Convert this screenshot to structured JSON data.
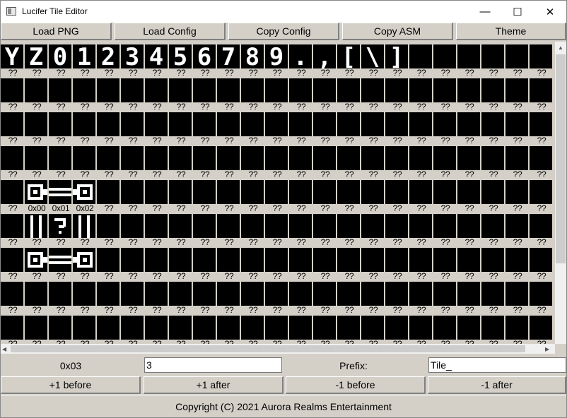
{
  "window": {
    "title": "Lucifer Tile Editor",
    "minimize_glyph": "—",
    "maximize_glyph": "☐",
    "close_glyph": "✕"
  },
  "toolbar": [
    {
      "label": "Load PNG"
    },
    {
      "label": "Load Config"
    },
    {
      "label": "Copy Config"
    },
    {
      "label": "Copy ASM"
    },
    {
      "label": "Theme"
    }
  ],
  "tiles": {
    "default_label": "??",
    "rows": 9,
    "cols": 23,
    "row0_glyphs": [
      "Y",
      "Z",
      "0",
      "1",
      "2",
      "3",
      "4",
      "5",
      "6",
      "7",
      "8",
      "9",
      ".",
      ",",
      "[",
      "\\",
      "]",
      "",
      "",
      "",
      "",
      "",
      ""
    ],
    "special_labels": [
      {
        "row": 4,
        "col": 1,
        "text": "0x00"
      },
      {
        "row": 4,
        "col": 2,
        "text": "0x01"
      },
      {
        "row": 4,
        "col": 3,
        "text": "0x02"
      }
    ],
    "bar_art": [
      {
        "row": 4,
        "cols": [
          1,
          2,
          3
        ]
      },
      {
        "row": 6,
        "cols": [
          1,
          2,
          3
        ]
      }
    ],
    "row5_art": [
      "pipe",
      "question",
      "pipe"
    ]
  },
  "info": {
    "code": "0x03",
    "number_value": "3",
    "prefix_label": "Prefix:",
    "prefix_value": "Tile_"
  },
  "stepper": [
    {
      "label": "+1 before"
    },
    {
      "label": "+1 after"
    },
    {
      "label": "-1 before"
    },
    {
      "label": "-1 after"
    }
  ],
  "footer": {
    "copyright": "Copyright (C) 2021 Aurora Realms Entertainment"
  },
  "colors": {
    "chrome": "#d4d0c8",
    "tile_bg": "#000000",
    "tile_fg": "#ffffff"
  }
}
